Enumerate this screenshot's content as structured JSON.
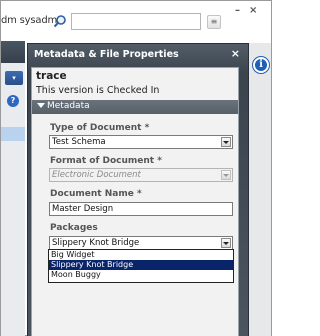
{
  "header": {
    "user_name": "dm sysadm",
    "search_value": "",
    "window_minimize": "–",
    "window_close": "×"
  },
  "dialog": {
    "title": "Metadata & File Properties",
    "close_label": "×"
  },
  "document": {
    "name": "trace",
    "status": "This version is Checked In"
  },
  "section": {
    "label": "Metadata"
  },
  "fields": {
    "type_label": "Type of Document *",
    "type_value": "Test Schema",
    "format_label": "Format of Document *",
    "format_value": "Electronic Document",
    "name_label": "Document Name *",
    "name_value": "Master Design",
    "packages_label": "Packages",
    "packages_value": "Slippery Knot Bridge"
  },
  "packages_options": [
    {
      "label": "Big Widget"
    },
    {
      "label": "Slippery Knot Bridge"
    },
    {
      "label": "Moon Buggy"
    }
  ],
  "left_panel": {
    "help_glyph": "?",
    "dropdown_glyph": "▾"
  },
  "info_badge": "i"
}
